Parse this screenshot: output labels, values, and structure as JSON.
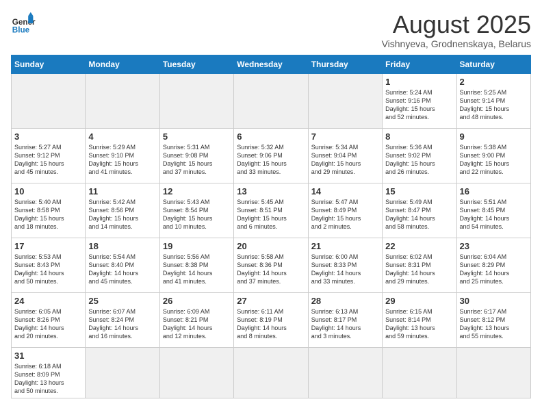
{
  "header": {
    "logo_general": "General",
    "logo_blue": "Blue",
    "title": "August 2025",
    "subtitle": "Vishnyeva, Grodnenskaya, Belarus"
  },
  "weekdays": [
    "Sunday",
    "Monday",
    "Tuesday",
    "Wednesday",
    "Thursday",
    "Friday",
    "Saturday"
  ],
  "weeks": [
    [
      {
        "day": "",
        "info": ""
      },
      {
        "day": "",
        "info": ""
      },
      {
        "day": "",
        "info": ""
      },
      {
        "day": "",
        "info": ""
      },
      {
        "day": "",
        "info": ""
      },
      {
        "day": "1",
        "info": "Sunrise: 5:24 AM\nSunset: 9:16 PM\nDaylight: 15 hours\nand 52 minutes."
      },
      {
        "day": "2",
        "info": "Sunrise: 5:25 AM\nSunset: 9:14 PM\nDaylight: 15 hours\nand 48 minutes."
      }
    ],
    [
      {
        "day": "3",
        "info": "Sunrise: 5:27 AM\nSunset: 9:12 PM\nDaylight: 15 hours\nand 45 minutes."
      },
      {
        "day": "4",
        "info": "Sunrise: 5:29 AM\nSunset: 9:10 PM\nDaylight: 15 hours\nand 41 minutes."
      },
      {
        "day": "5",
        "info": "Sunrise: 5:31 AM\nSunset: 9:08 PM\nDaylight: 15 hours\nand 37 minutes."
      },
      {
        "day": "6",
        "info": "Sunrise: 5:32 AM\nSunset: 9:06 PM\nDaylight: 15 hours\nand 33 minutes."
      },
      {
        "day": "7",
        "info": "Sunrise: 5:34 AM\nSunset: 9:04 PM\nDaylight: 15 hours\nand 29 minutes."
      },
      {
        "day": "8",
        "info": "Sunrise: 5:36 AM\nSunset: 9:02 PM\nDaylight: 15 hours\nand 26 minutes."
      },
      {
        "day": "9",
        "info": "Sunrise: 5:38 AM\nSunset: 9:00 PM\nDaylight: 15 hours\nand 22 minutes."
      }
    ],
    [
      {
        "day": "10",
        "info": "Sunrise: 5:40 AM\nSunset: 8:58 PM\nDaylight: 15 hours\nand 18 minutes."
      },
      {
        "day": "11",
        "info": "Sunrise: 5:42 AM\nSunset: 8:56 PM\nDaylight: 15 hours\nand 14 minutes."
      },
      {
        "day": "12",
        "info": "Sunrise: 5:43 AM\nSunset: 8:54 PM\nDaylight: 15 hours\nand 10 minutes."
      },
      {
        "day": "13",
        "info": "Sunrise: 5:45 AM\nSunset: 8:51 PM\nDaylight: 15 hours\nand 6 minutes."
      },
      {
        "day": "14",
        "info": "Sunrise: 5:47 AM\nSunset: 8:49 PM\nDaylight: 15 hours\nand 2 minutes."
      },
      {
        "day": "15",
        "info": "Sunrise: 5:49 AM\nSunset: 8:47 PM\nDaylight: 14 hours\nand 58 minutes."
      },
      {
        "day": "16",
        "info": "Sunrise: 5:51 AM\nSunset: 8:45 PM\nDaylight: 14 hours\nand 54 minutes."
      }
    ],
    [
      {
        "day": "17",
        "info": "Sunrise: 5:53 AM\nSunset: 8:43 PM\nDaylight: 14 hours\nand 50 minutes."
      },
      {
        "day": "18",
        "info": "Sunrise: 5:54 AM\nSunset: 8:40 PM\nDaylight: 14 hours\nand 45 minutes."
      },
      {
        "day": "19",
        "info": "Sunrise: 5:56 AM\nSunset: 8:38 PM\nDaylight: 14 hours\nand 41 minutes."
      },
      {
        "day": "20",
        "info": "Sunrise: 5:58 AM\nSunset: 8:36 PM\nDaylight: 14 hours\nand 37 minutes."
      },
      {
        "day": "21",
        "info": "Sunrise: 6:00 AM\nSunset: 8:33 PM\nDaylight: 14 hours\nand 33 minutes."
      },
      {
        "day": "22",
        "info": "Sunrise: 6:02 AM\nSunset: 8:31 PM\nDaylight: 14 hours\nand 29 minutes."
      },
      {
        "day": "23",
        "info": "Sunrise: 6:04 AM\nSunset: 8:29 PM\nDaylight: 14 hours\nand 25 minutes."
      }
    ],
    [
      {
        "day": "24",
        "info": "Sunrise: 6:05 AM\nSunset: 8:26 PM\nDaylight: 14 hours\nand 20 minutes."
      },
      {
        "day": "25",
        "info": "Sunrise: 6:07 AM\nSunset: 8:24 PM\nDaylight: 14 hours\nand 16 minutes."
      },
      {
        "day": "26",
        "info": "Sunrise: 6:09 AM\nSunset: 8:21 PM\nDaylight: 14 hours\nand 12 minutes."
      },
      {
        "day": "27",
        "info": "Sunrise: 6:11 AM\nSunset: 8:19 PM\nDaylight: 14 hours\nand 8 minutes."
      },
      {
        "day": "28",
        "info": "Sunrise: 6:13 AM\nSunset: 8:17 PM\nDaylight: 14 hours\nand 3 minutes."
      },
      {
        "day": "29",
        "info": "Sunrise: 6:15 AM\nSunset: 8:14 PM\nDaylight: 13 hours\nand 59 minutes."
      },
      {
        "day": "30",
        "info": "Sunrise: 6:17 AM\nSunset: 8:12 PM\nDaylight: 13 hours\nand 55 minutes."
      }
    ],
    [
      {
        "day": "31",
        "info": "Sunrise: 6:18 AM\nSunset: 8:09 PM\nDaylight: 13 hours\nand 50 minutes."
      },
      {
        "day": "",
        "info": ""
      },
      {
        "day": "",
        "info": ""
      },
      {
        "day": "",
        "info": ""
      },
      {
        "day": "",
        "info": ""
      },
      {
        "day": "",
        "info": ""
      },
      {
        "day": "",
        "info": ""
      }
    ]
  ]
}
